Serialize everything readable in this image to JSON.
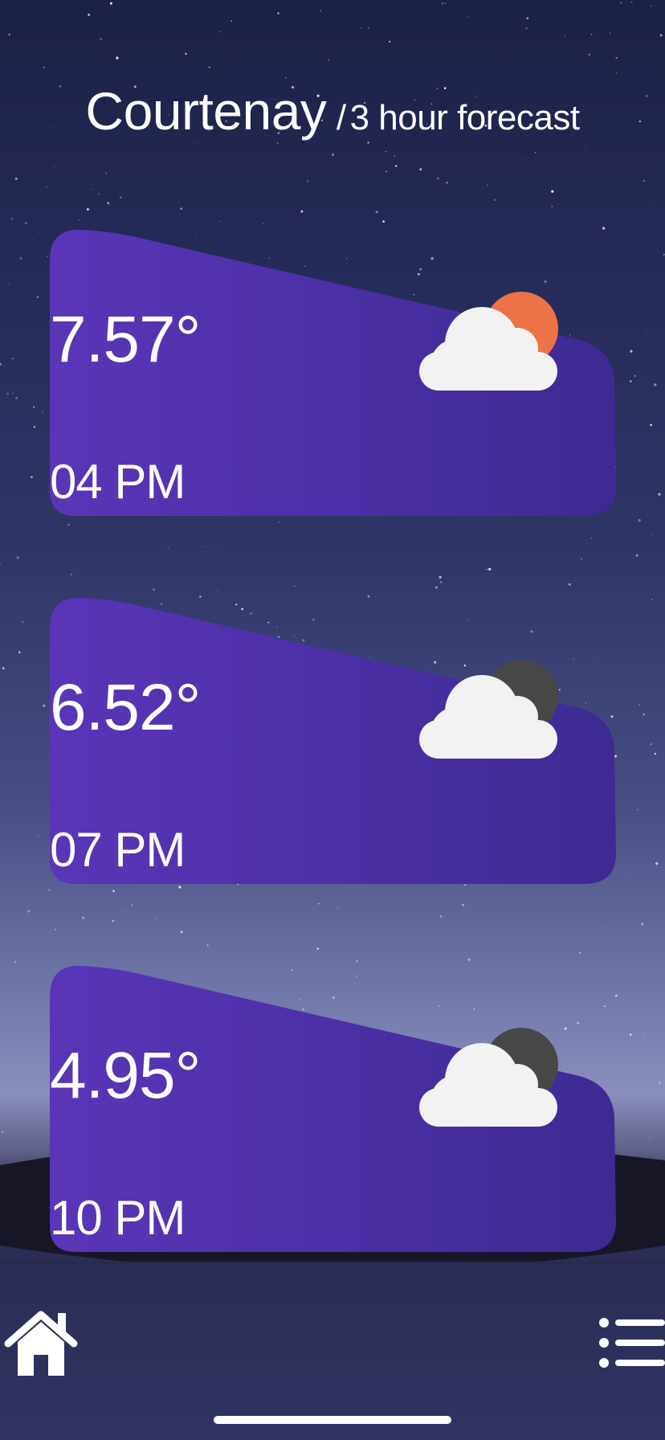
{
  "header": {
    "city": "Courtenay",
    "separator": "/",
    "subtitle": "3 hour forecast"
  },
  "forecasts": [
    {
      "temp": "7.57°",
      "time": "04 PM",
      "icon": "cloud-sun-icon"
    },
    {
      "temp": "6.52°",
      "time": "07 PM",
      "icon": "cloud-moon-icon"
    },
    {
      "temp": "4.95°",
      "time": "10 PM",
      "icon": "cloud-moon-icon"
    }
  ],
  "nav": {
    "home_icon": "home-icon",
    "menu_icon": "menu-list-icon"
  },
  "colors": {
    "card_gradient_start": "#5a35b8",
    "card_gradient_end": "#3e2a92",
    "sun": "#ee7248",
    "moon": "#474747",
    "cloud": "#f2f2f2"
  }
}
